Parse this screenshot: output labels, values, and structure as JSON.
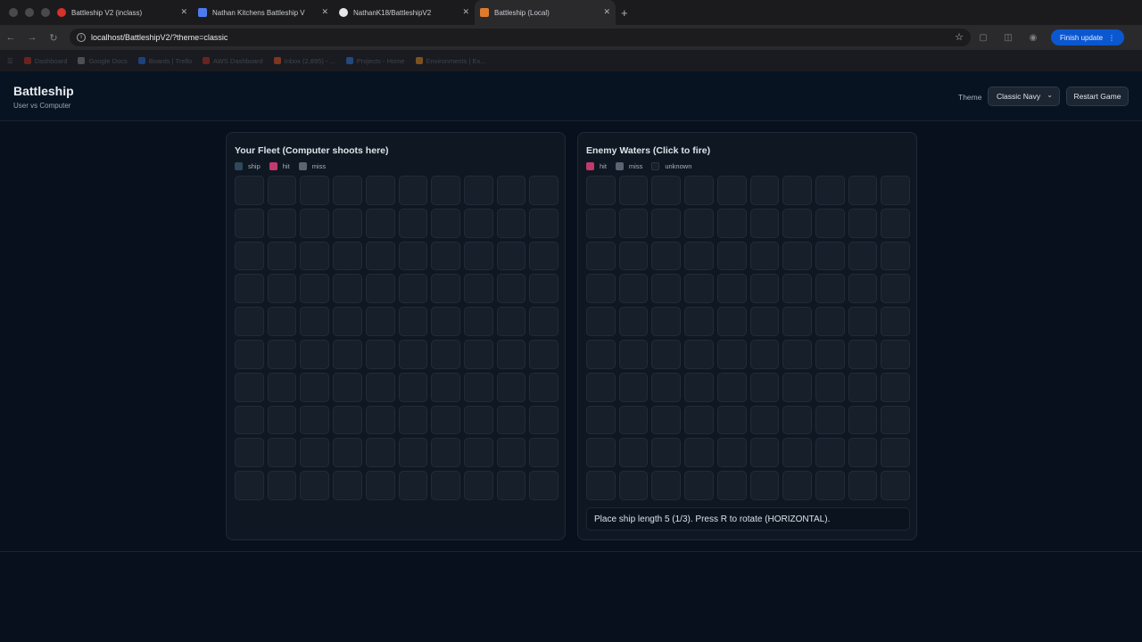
{
  "browser": {
    "tabs": [
      {
        "label": "Battleship V2 (inclass)",
        "icon": "opera-icon",
        "color": "#d6312b"
      },
      {
        "label": "Nathan Kitchens Battleship V",
        "icon": "docs-icon",
        "color": "#4c7bf0"
      },
      {
        "label": "NathanK18/BattleshipV2",
        "icon": "github-icon",
        "color": "#e6e6e6"
      },
      {
        "label": "Battleship (Local)",
        "icon": "local-icon",
        "color": "#e07a2b"
      }
    ],
    "url": "localhost/BattleshipV2/?theme=classic",
    "update_button": "Finish update",
    "bookmarks": [
      {
        "label": "Dashboard",
        "color": "#c0392b"
      },
      {
        "label": "Google Docs",
        "color": "#888888"
      },
      {
        "label": "Boards | Trello",
        "color": "#2f6fd6"
      },
      {
        "label": "AWS Dashboard",
        "color": "#c0392b"
      },
      {
        "label": "Inbox (2,895) - ...",
        "color": "#e05a2b"
      },
      {
        "label": "Projects - Home",
        "color": "#3a7bd5"
      },
      {
        "label": "Environments | Ex...",
        "color": "#e08b2b"
      }
    ]
  },
  "app": {
    "title": "Battleship",
    "subtitle": "User vs Computer",
    "theme_label": "Theme",
    "theme_value": "Classic Navy",
    "restart_label": "Restart Game"
  },
  "fleet": {
    "title": "Your Fleet (Computer shoots here)",
    "legend": [
      {
        "label": "ship",
        "color": "#2f4a5a"
      },
      {
        "label": "hit",
        "color": "#c23a6b"
      },
      {
        "label": "miss",
        "color": "#5b6470"
      }
    ]
  },
  "enemy": {
    "title": "Enemy Waters (Click to fire)",
    "legend": [
      {
        "label": "hit",
        "color": "#c23a6b"
      },
      {
        "label": "miss",
        "color": "#5b6470"
      },
      {
        "label": "unknown",
        "color": "#161f2a"
      }
    ],
    "status": "Place ship length 5 (1/3). Press R to rotate (HORIZONTAL)."
  }
}
